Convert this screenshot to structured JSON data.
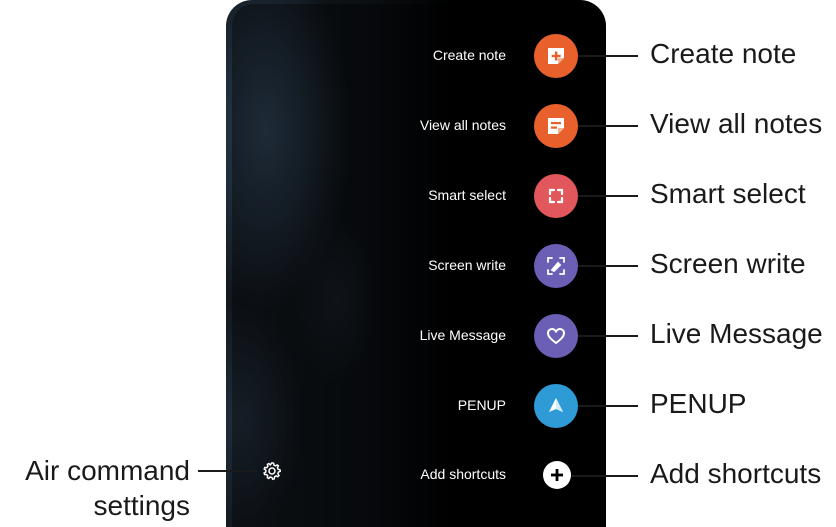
{
  "menu": {
    "items": [
      {
        "label": "Create note",
        "callout": "Create note",
        "color": "#e8612c",
        "icon": "create-note-icon"
      },
      {
        "label": "View all notes",
        "callout": "View all notes",
        "color": "#e8612c",
        "icon": "view-all-notes-icon"
      },
      {
        "label": "Smart select",
        "callout": "Smart select",
        "color": "#e2575c",
        "icon": "smart-select-icon"
      },
      {
        "label": "Screen write",
        "callout": "Screen write",
        "color": "#6a5fb5",
        "icon": "screen-write-icon"
      },
      {
        "label": "Live Message",
        "callout": "Live Message",
        "color": "#6a5fb5",
        "icon": "live-message-icon"
      },
      {
        "label": "PENUP",
        "callout": "PENUP",
        "color": "#2e9bd6",
        "icon": "penup-icon"
      },
      {
        "label": "Add shortcuts",
        "callout": "Add shortcuts",
        "color": "#ffffff",
        "icon": "add-icon"
      }
    ]
  },
  "settings": {
    "callout_line1": "Air command",
    "callout_line2": "settings",
    "icon": "gear-icon"
  }
}
